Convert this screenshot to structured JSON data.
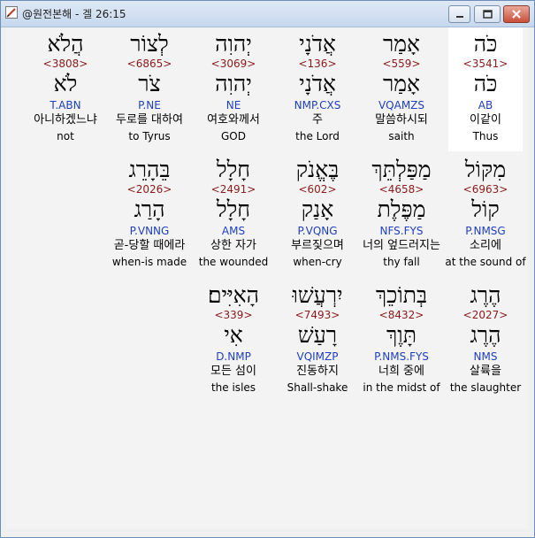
{
  "window": {
    "title": "@원전본해 - 겔 26:15",
    "icon": "app-pencil-icon"
  },
  "controls": {
    "minimize": "minimize-icon",
    "maximize": "maximize-icon",
    "close": "close-icon"
  },
  "rows": [
    [
      {
        "heb": "כֹּה",
        "num": "<3541>",
        "lemma": "כֹּה",
        "parse": "AB",
        "kor": "이같이",
        "eng": "Thus",
        "highlight": true
      },
      {
        "heb": "אָמַר",
        "num": "<559>",
        "lemma": "אָמַר",
        "parse": "VQAMZS",
        "kor": "말씀하시되",
        "eng": "saith"
      },
      {
        "heb": "אֲדֹנָי",
        "num": "<136>",
        "lemma": "אֲדֹנָי",
        "parse": "NMP.CXS",
        "kor": "주",
        "eng": "the Lord"
      },
      {
        "heb": "יְהוִה",
        "num": "<3069>",
        "lemma": "יְהוִה",
        "parse": "NE",
        "kor": "여호와께서",
        "eng": "GOD"
      },
      {
        "heb": "לְצוֹר",
        "num": "<6865>",
        "lemma": "צֹר",
        "parse": "P.NE",
        "kor": "두로를 대하여",
        "eng": "to Tyrus"
      },
      {
        "heb": "הֲלֹא",
        "num": "<3808>",
        "lemma": "לֹא",
        "parse": "T.ABN",
        "kor": "아니하겠느냐",
        "eng": "not"
      }
    ],
    [
      {
        "heb": "מִקּוֹל",
        "num": "<6963>",
        "lemma": "קוֹל",
        "parse": "P.NMSG",
        "kor": "소리에",
        "eng": "at the sound of"
      },
      {
        "heb": "מַפַּלְתֵּךְ",
        "num": "<4658>",
        "lemma": "מַפֶּלֶת",
        "parse": "NFS.FYS",
        "kor": "너의 엎드러지는",
        "eng": "thy fall"
      },
      {
        "heb": "בֶּאֱנֹק",
        "num": "<602>",
        "lemma": "אָנַק",
        "parse": "P.VQNG",
        "kor": "부르짖으며",
        "eng": "when-cry"
      },
      {
        "heb": "חָלָל",
        "num": "<2491>",
        "lemma": "חָלָל",
        "parse": "AMS",
        "kor": "상한 자가",
        "eng": "the wounded"
      },
      {
        "heb": "בֵּהָרֵג",
        "num": "<2026>",
        "lemma": "הָרַג",
        "parse": "P.VNNG",
        "kor": "곧-당할 때에라",
        "eng": "when-is made"
      }
    ],
    [
      {
        "heb": "הֶרֶג",
        "num": "<2027>",
        "lemma": "הֶרֶג",
        "parse": "NMS",
        "kor": "살륙을",
        "eng": "the slaughter"
      },
      {
        "heb": "בְּתוֹכֵךְ",
        "num": "<8432>",
        "lemma": "תָּוֶךְ",
        "parse": "P.NMS.FYS",
        "kor": "너희 중에",
        "eng": "in the midst of"
      },
      {
        "heb": "יִרְעֲשׁוּ",
        "num": "<7493>",
        "lemma": "רָעַשׁ",
        "parse": "VQIMZP",
        "kor": "진동하지",
        "eng": "Shall-shake"
      },
      {
        "heb": "הָאִיִּים׃",
        "num": "<339>",
        "lemma": "אִי",
        "parse": "D.NMP",
        "kor": "모든 섬이",
        "eng": "the isles"
      }
    ]
  ]
}
